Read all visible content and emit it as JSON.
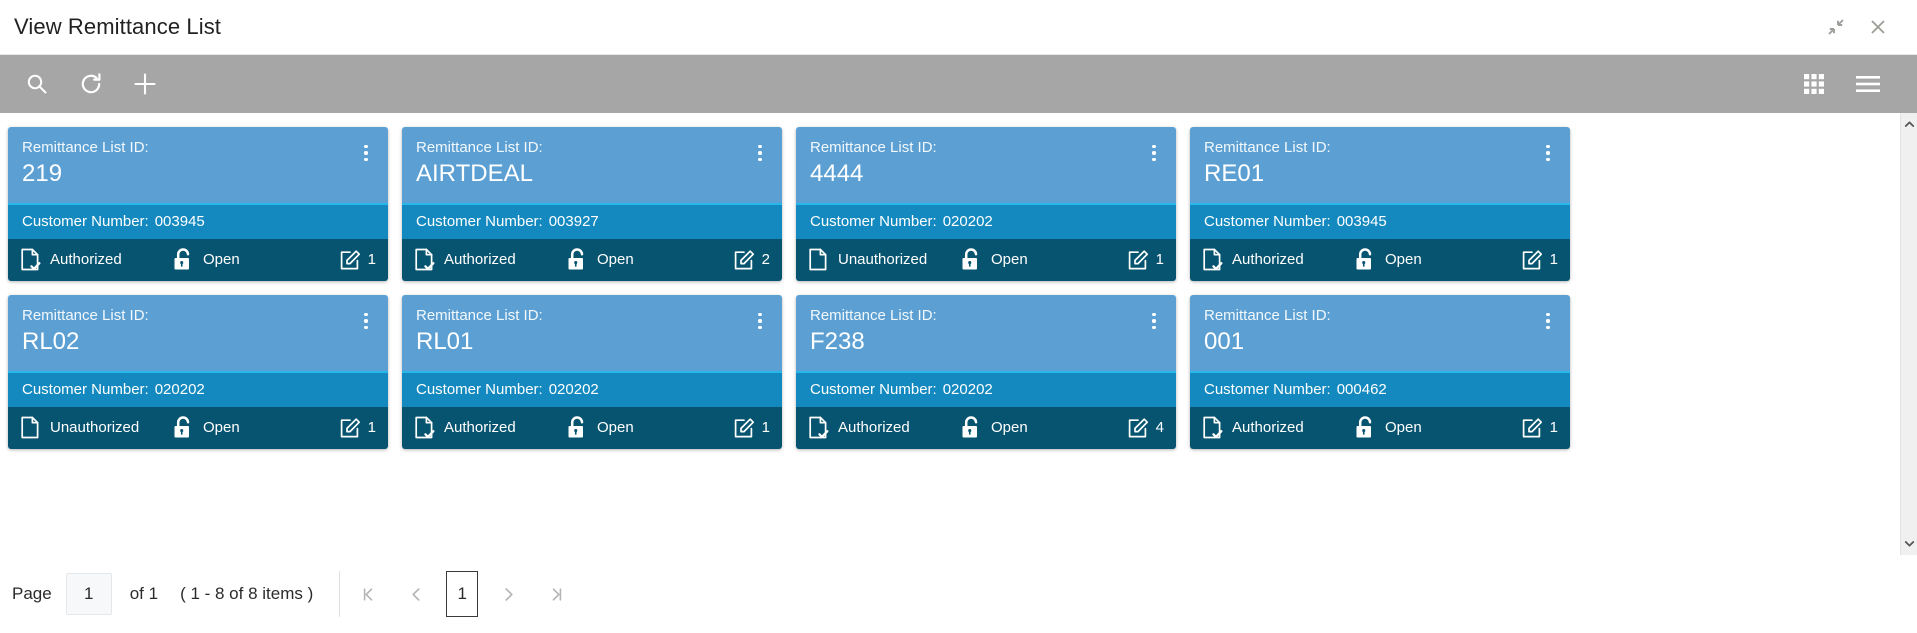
{
  "window": {
    "title": "View Remittance List",
    "restore_icon": "restore-down-icon",
    "close_icon": "close-icon"
  },
  "toolbar": {
    "search_icon": "search-icon",
    "refresh_icon": "refresh-icon",
    "add_icon": "plus-icon",
    "grid_view_icon": "grid-view-icon",
    "menu_icon": "hamburger-menu-icon"
  },
  "colors": {
    "card_header": "#5ca0d3",
    "card_sub": "#1389bf",
    "card_sub_accent": "#29b6e8",
    "card_footer": "#075470",
    "toolbar_bg": "#a6a6a6",
    "title_text": "#222222"
  },
  "card_labels": {
    "id_label": "Remittance List ID:",
    "customer_label": "Customer Number:"
  },
  "cards": [
    {
      "id": "219",
      "customer_number": "003945",
      "auth_status": "Authorized",
      "auth_icon": "document-check-icon",
      "lock_status": "Open",
      "lock_icon": "unlock-icon",
      "edit_icon": "edit-square-icon",
      "edit_count": "1"
    },
    {
      "id": "AIRTDEAL",
      "customer_number": "003927",
      "auth_status": "Authorized",
      "auth_icon": "document-check-icon",
      "lock_status": "Open",
      "lock_icon": "unlock-icon",
      "edit_icon": "edit-square-icon",
      "edit_count": "2"
    },
    {
      "id": "4444",
      "customer_number": "020202",
      "auth_status": "Unauthorized",
      "auth_icon": "document-icon",
      "lock_status": "Open",
      "lock_icon": "unlock-icon",
      "edit_icon": "edit-square-icon",
      "edit_count": "1"
    },
    {
      "id": "RE01",
      "customer_number": "003945",
      "auth_status": "Authorized",
      "auth_icon": "document-check-icon",
      "lock_status": "Open",
      "lock_icon": "unlock-icon",
      "edit_icon": "edit-square-icon",
      "edit_count": "1"
    },
    {
      "id": "RL02",
      "customer_number": "020202",
      "auth_status": "Unauthorized",
      "auth_icon": "document-icon",
      "lock_status": "Open",
      "lock_icon": "unlock-icon",
      "edit_icon": "edit-square-icon",
      "edit_count": "1"
    },
    {
      "id": "RL01",
      "customer_number": "020202",
      "auth_status": "Authorized",
      "auth_icon": "document-check-icon",
      "lock_status": "Open",
      "lock_icon": "unlock-icon",
      "edit_icon": "edit-square-icon",
      "edit_count": "1"
    },
    {
      "id": "F238",
      "customer_number": "020202",
      "auth_status": "Authorized",
      "auth_icon": "document-check-icon",
      "lock_status": "Open",
      "lock_icon": "unlock-icon",
      "edit_icon": "edit-square-icon",
      "edit_count": "4"
    },
    {
      "id": "001",
      "customer_number": "000462",
      "auth_status": "Authorized",
      "auth_icon": "document-check-icon",
      "lock_status": "Open",
      "lock_icon": "unlock-icon",
      "edit_icon": "edit-square-icon",
      "edit_count": "1"
    }
  ],
  "pagination": {
    "page_label": "Page",
    "page_value": "1",
    "of_text": "of 1",
    "items_text": "( 1 - 8 of 8 items )",
    "first_icon": "first-page-icon",
    "prev_icon": "previous-page-icon",
    "current_page": "1",
    "next_icon": "next-page-icon",
    "last_icon": "last-page-icon"
  },
  "scrollbar": {
    "up_icon": "chevron-up-icon",
    "down_icon": "chevron-down-icon"
  }
}
